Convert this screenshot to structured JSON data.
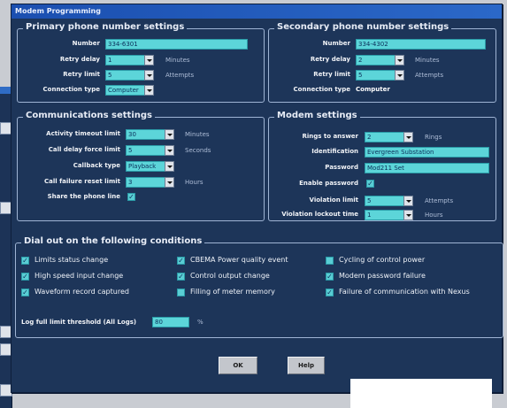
{
  "window": {
    "title": "Modem Programming"
  },
  "primary": {
    "legend": "Primary phone number settings",
    "number_label": "Number",
    "number_value": "334-6301",
    "retry_delay_label": "Retry delay",
    "retry_delay_value": "1",
    "retry_delay_unit": "Minutes",
    "retry_limit_label": "Retry limit",
    "retry_limit_value": "5",
    "retry_limit_unit": "Attempts",
    "connection_type_label": "Connection type",
    "connection_type_value": "Computer"
  },
  "secondary": {
    "legend": "Secondary phone number settings",
    "number_label": "Number",
    "number_value": "334-4302",
    "retry_delay_label": "Retry delay",
    "retry_delay_value": "2",
    "retry_delay_unit": "Minutes",
    "retry_limit_label": "Retry limit",
    "retry_limit_value": "5",
    "retry_limit_unit": "Attempts",
    "connection_type_label": "Connection type",
    "connection_type_value": "Computer"
  },
  "communications": {
    "legend": "Communications settings",
    "activity_label": "Activity timeout limit",
    "activity_value": "30",
    "activity_unit": "Minutes",
    "call_delay_label": "Call delay force limit",
    "call_delay_value": "5",
    "call_delay_unit": "Seconds",
    "callback_label": "Callback type",
    "callback_value": "Playback",
    "call_failure_label": "Call failure reset limit",
    "call_failure_value": "3",
    "call_failure_unit": "Hours",
    "share_label": "Share the phone line",
    "share_checked": "✓"
  },
  "modem": {
    "legend": "Modem settings",
    "rings_label": "Rings to answer",
    "rings_value": "2",
    "rings_unit": "Rings",
    "identification_label": "Identification",
    "identification_value": "Evergreen Substation",
    "password_label": "Password",
    "password_value": "Mod211 Set",
    "enable_password_label": "Enable password",
    "enable_password_checked": "✓",
    "violation_limit_label": "Violation limit",
    "violation_limit_value": "5",
    "violation_limit_unit": "Attempts",
    "violation_lockout_label": "Violation lockout time",
    "violation_lockout_value": "1",
    "violation_lockout_unit": "Hours"
  },
  "dial_out": {
    "legend": "Dial out on the following conditions",
    "conditions": [
      {
        "label": "Limits status change",
        "checked": "✓"
      },
      {
        "label": "CBEMA Power quality event",
        "checked": "✓"
      },
      {
        "label": "Cycling of control power",
        "checked": ""
      },
      {
        "label": "High speed input change",
        "checked": "✓"
      },
      {
        "label": "Control output change",
        "checked": "✓"
      },
      {
        "label": "Modem password failure",
        "checked": "✓"
      },
      {
        "label": "Waveform record captured",
        "checked": "✓"
      },
      {
        "label": "Filling of meter memory",
        "checked": ""
      },
      {
        "label": "Failure of communication with Nexus",
        "checked": "✓"
      }
    ],
    "log_threshold_label": "Log full limit threshold (All Logs)",
    "log_threshold_value": "80",
    "log_threshold_unit": "%"
  },
  "buttons": {
    "ok": "OK",
    "help": "Help"
  },
  "colors": {
    "dialog_bg": "#1d3559",
    "field_bg": "#5cd5d9",
    "titlebar": "#1b4fb0"
  }
}
